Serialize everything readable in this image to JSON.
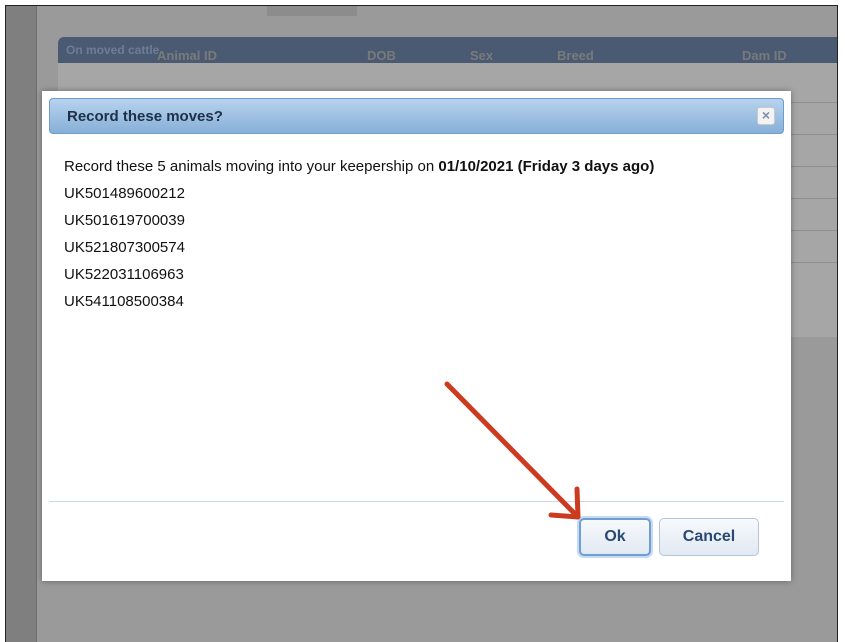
{
  "background": {
    "panel_title": "On moved cattle",
    "columns": [
      "Animal ID",
      "DOB",
      "Sex",
      "Breed",
      "Dam ID"
    ]
  },
  "dialog": {
    "title": "Record these moves?",
    "message_prefix": "Record these 5 animals moving into your keepership on ",
    "message_date": "01/10/2021 (Friday 3 days ago)",
    "animals": [
      "UK501489600212",
      "UK501619700039",
      "UK521807300574",
      "UK522031106963",
      "UK541108500384"
    ],
    "close_label": "×",
    "ok_label": "Ok",
    "cancel_label": "Cancel"
  },
  "annotation": {
    "arrow_color": "#cc3a1f"
  }
}
